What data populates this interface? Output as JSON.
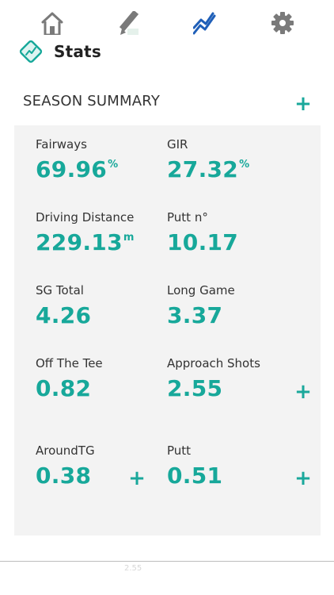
{
  "header": {
    "title": "Stats",
    "logo_icon": "stats-logo-icon"
  },
  "season_summary": {
    "title": "SEASON SUMMARY",
    "add_icon": "plus-icon"
  },
  "stats": {
    "fairways": {
      "label": "Fairways",
      "value": "69.96",
      "unit": "%"
    },
    "gir": {
      "label": "GIR",
      "value": "27.32",
      "unit": "%"
    },
    "driving_distance": {
      "label": "Driving Distance",
      "value": "229.13",
      "unit": "m"
    },
    "putt_n": {
      "label": "Putt n°",
      "value": "10.17"
    },
    "sg_total": {
      "label": "SG Total",
      "value": "4.26"
    },
    "long_game": {
      "label": "Long Game",
      "value": "3.37"
    },
    "off_the_tee": {
      "label": "Off The Tee",
      "value": "0.82"
    },
    "approach_shots": {
      "label": "Approach Shots",
      "value": "2.55"
    },
    "around_tg": {
      "label": "AroundTG",
      "value": "0.38"
    },
    "putt": {
      "label": "Putt",
      "value": "0.51"
    }
  },
  "nav": {
    "ghost_text": "2.55",
    "items": [
      "home-icon",
      "pencil-icon",
      "chart-line-icon",
      "gear-icon"
    ]
  },
  "colors": {
    "accent": "#17a89a",
    "card_bg": "#f3f3f3",
    "icon_gray": "#7a7a7a"
  }
}
